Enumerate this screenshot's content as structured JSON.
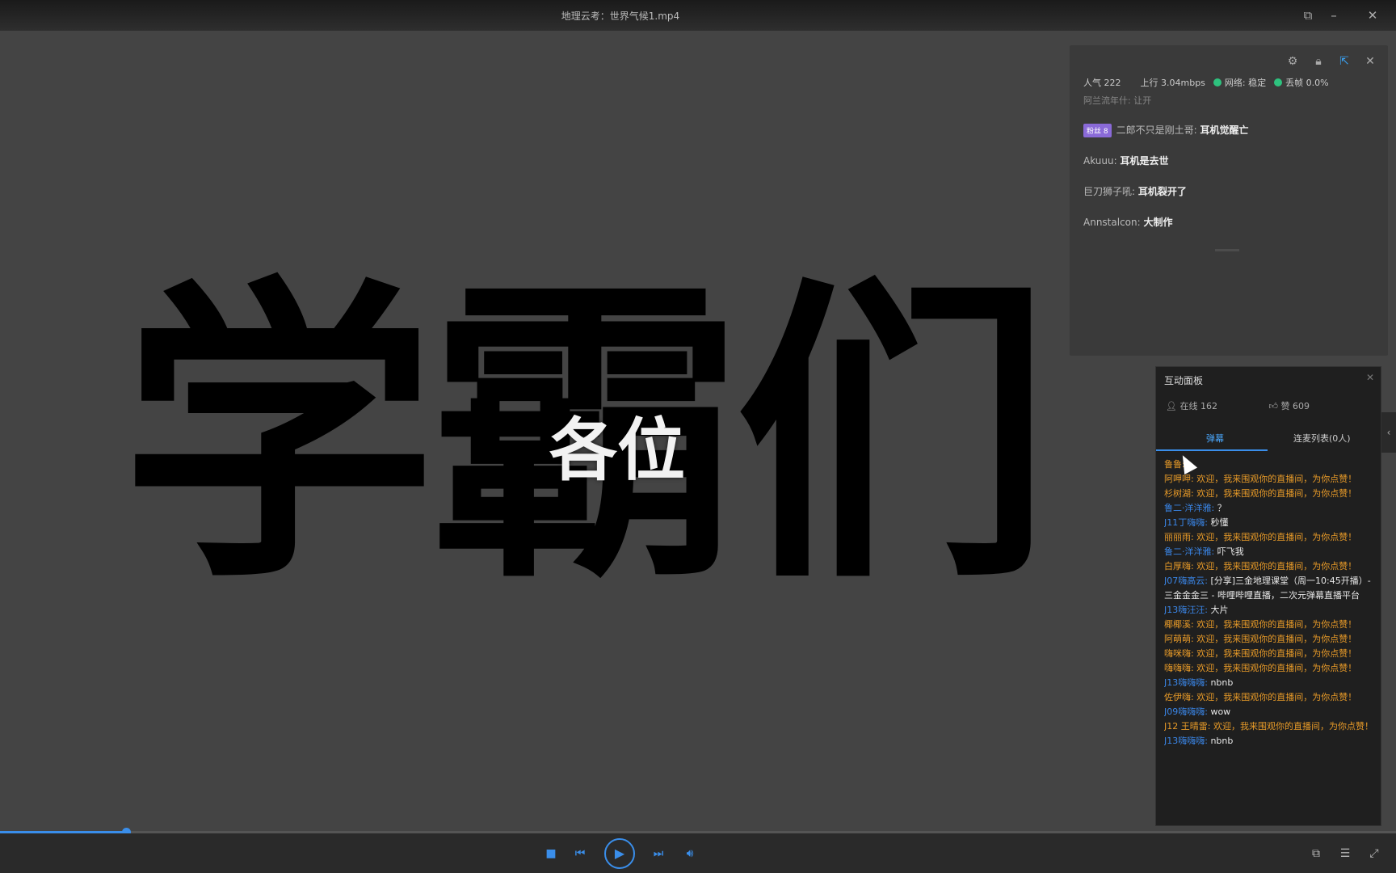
{
  "window": {
    "title": "地理云考：世界气候1.mp4"
  },
  "video": {
    "big_text": "学霸们",
    "overlay_text": "各位"
  },
  "live_panel": {
    "stats": {
      "popularity_label": "人气",
      "popularity_value": "222",
      "upload_label": "上行",
      "upload_value": "3.04mbps",
      "network_label": "网络: 稳定",
      "drop_label": "丢帧 0.0%"
    },
    "faded_line": "阿兰流年什: 让开",
    "messages": [
      {
        "badge": "粉丝 8",
        "user": "二郎不只是刚土哥:",
        "text": "耳机觉醒亡"
      },
      {
        "badge": "",
        "user": "Akuuu:",
        "text": "耳机是去世"
      },
      {
        "badge": "",
        "user": "巨刀狮子吼:",
        "text": "耳机裂开了"
      },
      {
        "badge": "",
        "user": "Annstalcon:",
        "text": "大制作"
      }
    ]
  },
  "interaction_panel": {
    "title": "互动面板",
    "online_label": "在线 162",
    "likes_label": "赞 609",
    "tabs": [
      {
        "label": "弹幕"
      },
      {
        "label": "连麦列表(0人)"
      }
    ],
    "lines": [
      {
        "user": "鲁鲁:",
        "user_color": "orange",
        "text": "",
        "text_color": "orange"
      },
      {
        "user": "阿呷呷:",
        "user_color": "orange",
        "text": "欢迎，我来围观你的直播间，为你点赞！",
        "text_color": "orange"
      },
      {
        "user": "杉树湖:",
        "user_color": "orange",
        "text": "欢迎，我来围观你的直播间，为你点赞！",
        "text_color": "orange"
      },
      {
        "user": "鲁二·洋洋雅:",
        "user_color": "blue",
        "text": "？",
        "text_color": "white"
      },
      {
        "user": "J11丁嗨嗨:",
        "user_color": "blue",
        "text": "秒懂",
        "text_color": "white"
      },
      {
        "user": "丽丽雨:",
        "user_color": "orange",
        "text": "欢迎，我来围观你的直播间，为你点赞！",
        "text_color": "orange"
      },
      {
        "user": "鲁二·洋洋雅:",
        "user_color": "blue",
        "text": "吓飞我",
        "text_color": "white"
      },
      {
        "user": "白厚嗨:",
        "user_color": "orange",
        "text": "欢迎，我来围观你的直播间，为你点赞！",
        "text_color": "orange"
      },
      {
        "user": "J07嗨高云:",
        "user_color": "blue",
        "text": "[分享]三金地理课堂（周一10:45开播）- 三金金金三 - 哔哩哔哩直播，二次元弹幕直播平台",
        "text_color": "white",
        "wrap": true
      },
      {
        "user": "J13嗨汪汪:",
        "user_color": "blue",
        "text": "大片",
        "text_color": "white"
      },
      {
        "user": "椰椰溪:",
        "user_color": "orange",
        "text": "欢迎，我来围观你的直播间，为你点赞！",
        "text_color": "orange"
      },
      {
        "user": "阿萌萌:",
        "user_color": "orange",
        "text": "欢迎，我来围观你的直播间，为你点赞！",
        "text_color": "orange"
      },
      {
        "user": "嗨咪嗨:",
        "user_color": "orange",
        "text": "欢迎，我来围观你的直播间，为你点赞！",
        "text_color": "orange"
      },
      {
        "user": "嗨嗨嗨:",
        "user_color": "orange",
        "text": "欢迎，我来围观你的直播间，为你点赞！",
        "text_color": "orange"
      },
      {
        "user": "J13嗨嗨嗨:",
        "user_color": "blue",
        "text": "nbnb",
        "text_color": "white"
      },
      {
        "user": "佐伊嗨:",
        "user_color": "orange",
        "text": "欢迎，我来围观你的直播间，为你点赞！",
        "text_color": "orange"
      },
      {
        "user": "J09嗨嗨嗨:",
        "user_color": "blue",
        "text": "wow",
        "text_color": "white"
      },
      {
        "user": "J12 王晴雷:",
        "user_color": "orange",
        "text": "欢迎，我来围观你的直播间，为你点赞！",
        "text_color": "orange",
        "wrap": true
      },
      {
        "user": "J13嗨嗨嗨:",
        "user_color": "blue",
        "text": "nbnb",
        "text_color": "white"
      }
    ]
  },
  "player": {
    "progress_fraction": 0.09
  },
  "colors": {
    "accent": "#3a8eea",
    "background": "#424242",
    "panel": "#1f1f1f"
  }
}
